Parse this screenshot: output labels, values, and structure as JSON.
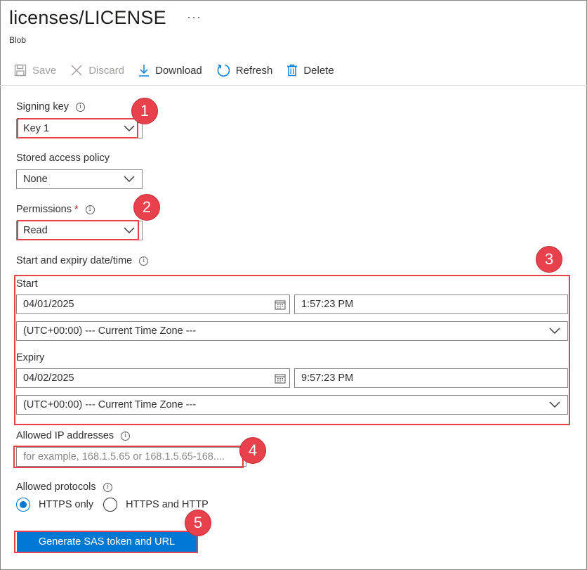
{
  "header": {
    "title": "licenses/LICENSE",
    "more": "···",
    "subtitle": "Blob"
  },
  "toolbar": {
    "save_label": "Save",
    "discard_label": "Discard",
    "download_label": "Download",
    "refresh_label": "Refresh",
    "delete_label": "Delete"
  },
  "signing_key": {
    "label": "Signing key",
    "value": "Key 1"
  },
  "stored_policy": {
    "label": "Stored access policy",
    "value": "None"
  },
  "permissions": {
    "label": "Permissions",
    "required_mark": "*",
    "value": "Read"
  },
  "datetime": {
    "label": "Start and expiry date/time",
    "start_label": "Start",
    "start_date": "04/01/2025",
    "start_time": "1:57:23 PM",
    "start_tz": "(UTC+00:00) --- Current Time Zone ---",
    "expiry_label": "Expiry",
    "expiry_date": "04/02/2025",
    "expiry_time": "9:57:23 PM",
    "expiry_tz": "(UTC+00:00) --- Current Time Zone ---"
  },
  "allowed_ip": {
    "label": "Allowed IP addresses",
    "placeholder": "for example, 168.1.5.65 or 168.1.5.65-168...."
  },
  "protocols": {
    "label": "Allowed protocols",
    "options": [
      "HTTPS only",
      "HTTPS and HTTP"
    ],
    "selected": "HTTPS only"
  },
  "generate_button": "Generate SAS token and URL",
  "callouts": [
    "1",
    "2",
    "3",
    "4",
    "5"
  ],
  "colors": {
    "accent": "#0078d4",
    "callout": "#e8414d"
  }
}
